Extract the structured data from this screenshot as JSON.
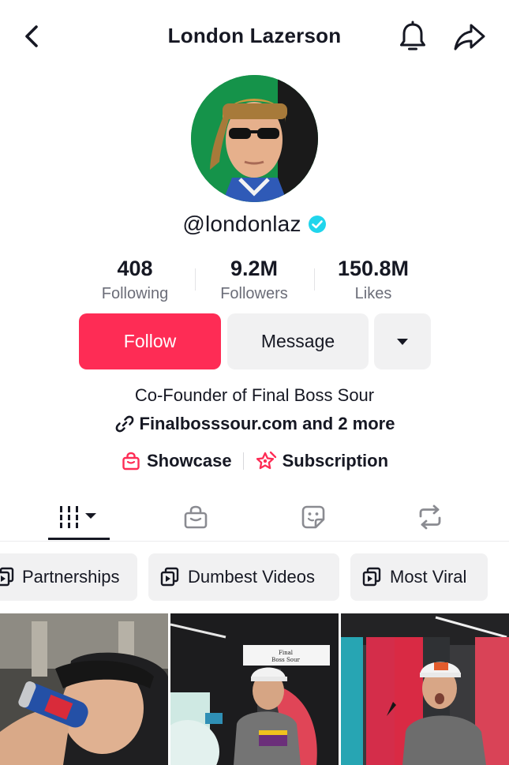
{
  "header": {
    "title": "London Lazerson",
    "back_icon": "chevron-left-icon",
    "bell_icon": "bell-icon",
    "share_icon": "share-icon"
  },
  "profile": {
    "handle": "@londonlaz",
    "verified": true
  },
  "stats": [
    {
      "value": "408",
      "label": "Following"
    },
    {
      "value": "9.2M",
      "label": "Followers"
    },
    {
      "value": "150.8M",
      "label": "Likes"
    }
  ],
  "actions": {
    "follow_label": "Follow",
    "message_label": "Message",
    "more_icon": "caret-down-icon"
  },
  "bio": {
    "text": "Co-Founder of Final Boss Sour",
    "link_text": "Finalbosssour.com and 2 more",
    "showcase_label": "Showcase",
    "subscription_label": "Subscription"
  },
  "tabs": [
    {
      "name": "videos",
      "icon": "grid-icon",
      "active": true
    },
    {
      "name": "shop",
      "icon": "bag-icon",
      "active": false
    },
    {
      "name": "stickers",
      "icon": "sticker-icon",
      "active": false
    },
    {
      "name": "reposts",
      "icon": "repost-icon",
      "active": false
    }
  ],
  "playlists": [
    {
      "label": "Partnerships"
    },
    {
      "label": "Dumbest Videos"
    },
    {
      "label": "Most Viral"
    }
  ],
  "thumbnails": [
    {
      "alt": "video-1"
    },
    {
      "alt": "video-2",
      "overlay_text_1": "Final",
      "overlay_text_2": "Boss Sour"
    },
    {
      "alt": "video-3"
    }
  ],
  "colors": {
    "accent": "#fe2c55",
    "verified": "#20d5ec",
    "button_gray": "#f1f1f2",
    "text": "#161823"
  }
}
